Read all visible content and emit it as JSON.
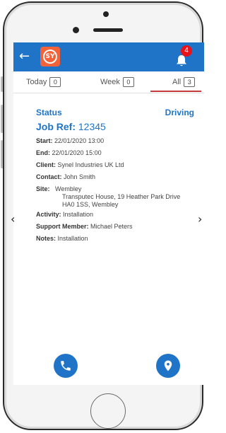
{
  "header": {
    "back_glyph": "←",
    "logo_text": "SY",
    "notification_count": "4",
    "accent_color": "#1f74c7",
    "logo_color": "#f4623a"
  },
  "tabs": [
    {
      "label": "Today",
      "count": "0",
      "selected": false
    },
    {
      "label": "Week",
      "count": "0",
      "selected": false
    },
    {
      "label": "All",
      "count": "3",
      "selected": true
    }
  ],
  "job": {
    "status_label": "Status",
    "status_value": "Driving",
    "jobref_label": "Job Ref:",
    "jobref_value": "12345",
    "fields": [
      {
        "key": "Start:",
        "value": "22/01/2020 13:00"
      },
      {
        "key": "End:",
        "value": "22/01/2020 15:00"
      },
      {
        "key": "Client:",
        "value": "Synel Industries UK Ltd"
      },
      {
        "key": "Contact:",
        "value": "John Smith"
      }
    ],
    "site_key": "Site:",
    "site_lines": [
      "Wembley",
      "Transputec House, 19 Heather Park Drive",
      "HA0 1SS, Wembley"
    ],
    "after_fields": [
      {
        "key": "Activity:",
        "value": "Installation"
      },
      {
        "key": "Support Member:",
        "value": "Michael Peters"
      },
      {
        "key": "Notes:",
        "value": "Installation"
      }
    ]
  },
  "nav": {
    "prev": "‹",
    "next": "›"
  },
  "icons": [
    "back-arrow-icon",
    "bell-icon",
    "phone-icon",
    "location-pin-icon"
  ]
}
